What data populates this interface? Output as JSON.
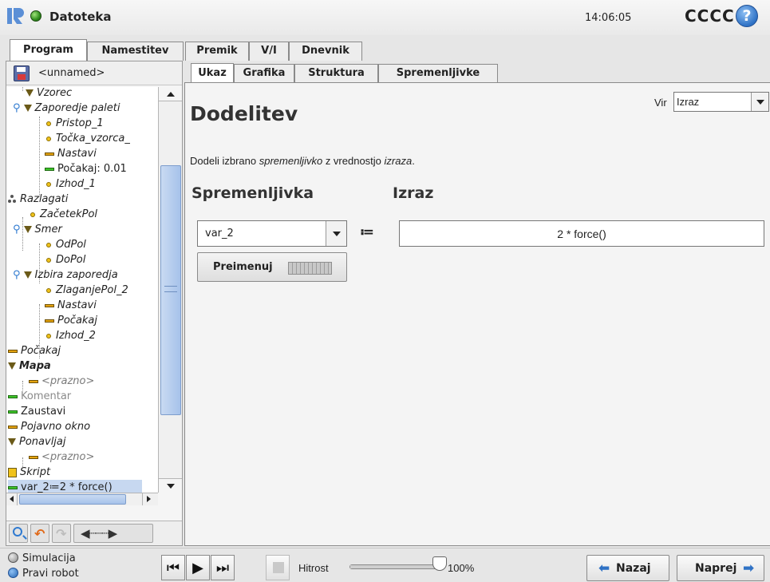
{
  "header": {
    "file_title": "Datoteka",
    "clock": "14:06:05",
    "robot_name": "CCCC",
    "help_glyph": "?",
    "status_color": "#3cae21",
    "accent_color": "#2f72c5"
  },
  "main_tabs": [
    {
      "label": "Program",
      "active": true
    },
    {
      "label": "Namestitev",
      "active": false
    },
    {
      "label": "Premik",
      "active": false
    },
    {
      "label": "V/I",
      "active": false
    },
    {
      "label": "Dnevnik",
      "active": false
    }
  ],
  "left_panel": {
    "program_name": "<unnamed>",
    "tree": [
      {
        "label": "Vzorec",
        "icon": "triangle-icon",
        "depth": 1
      },
      {
        "label": "Zaporedje paleti",
        "icon": "triangle-icon",
        "depth": 0
      },
      {
        "label": "Pristop_1",
        "icon": "waypoint-icon",
        "depth": 2
      },
      {
        "label": "Točka_vzorca_",
        "icon": "waypoint-icon",
        "depth": 2
      },
      {
        "label": "Nastavi",
        "icon": "set-icon",
        "depth": 2
      },
      {
        "label": "Počakaj: 0.01",
        "icon": "wait-icon",
        "depth": 2
      },
      {
        "label": "Izhod_1",
        "icon": "waypoint-icon",
        "depth": 2
      },
      {
        "label": "Razlagati",
        "icon": "palletize-icon",
        "depth": -1
      },
      {
        "label": "ZačetekPol",
        "icon": "waypoint-icon",
        "depth": 0
      },
      {
        "label": "Smer",
        "icon": "triangle-icon",
        "depth": 0
      },
      {
        "label": "OdPol",
        "icon": "waypoint-icon",
        "depth": 2
      },
      {
        "label": "DoPol",
        "icon": "waypoint-icon",
        "depth": 2
      },
      {
        "label": "Izbira zaporedja",
        "icon": "triangle-icon",
        "depth": 0
      },
      {
        "label": "ZlaganjePol_2",
        "icon": "waypoint-icon",
        "depth": 2
      },
      {
        "label": "Nastavi",
        "icon": "set-icon",
        "depth": 2
      },
      {
        "label": "Počakaj",
        "icon": "wait-icon",
        "depth": 2
      },
      {
        "label": "Izhod_2",
        "icon": "waypoint-icon",
        "depth": 2
      },
      {
        "label": "Počakaj",
        "icon": "wait-icon",
        "depth": -1
      },
      {
        "label": "Mapa",
        "icon": "folder-icon",
        "depth": -1
      },
      {
        "label": "<prazno>",
        "icon": "empty-icon",
        "depth": 0
      },
      {
        "label": "Komentar",
        "icon": "comment-icon",
        "depth": -1
      },
      {
        "label": "Zaustavi",
        "icon": "halt-icon",
        "depth": -1
      },
      {
        "label": "Pojavno okno",
        "icon": "popup-icon",
        "depth": -1
      },
      {
        "label": "Ponavljaj",
        "icon": "loop-icon",
        "depth": -1
      },
      {
        "label": "<prazno>",
        "icon": "empty-icon",
        "depth": 0
      },
      {
        "label": "Skript",
        "icon": "script-icon",
        "depth": -1
      },
      {
        "label": "var_2≔2 * force()",
        "icon": "assignment-icon",
        "depth": -1
      }
    ]
  },
  "sub_tabs": [
    {
      "label": "Ukaz",
      "active": true
    },
    {
      "label": "Grafika",
      "active": false
    },
    {
      "label": "Struktura",
      "active": false
    },
    {
      "label": "Spremenljivke",
      "active": false
    }
  ],
  "content": {
    "title": "Dodelitev",
    "source_label": "Vir",
    "source_value": "Izraz",
    "description_prefix": "Dodeli izbrano ",
    "description_var": "spremenljivko",
    "description_middle": " z vrednostjo ",
    "description_expr": "izraza",
    "description_suffix": ".",
    "variable_heading": "Spremenljivka",
    "expression_heading": "Izraz",
    "variable_value": "var_2",
    "assign_operator": "≔",
    "expression_value": "2 * force()",
    "rename_label": "Preimenuj"
  },
  "footer": {
    "mode_simulation": "Simulacija",
    "mode_real": "Pravi robot",
    "speed_label": "Hitrost",
    "speed_value": "100%",
    "speed_fraction": 1.0,
    "back_label": "Nazaj",
    "next_label": "Naprej"
  }
}
